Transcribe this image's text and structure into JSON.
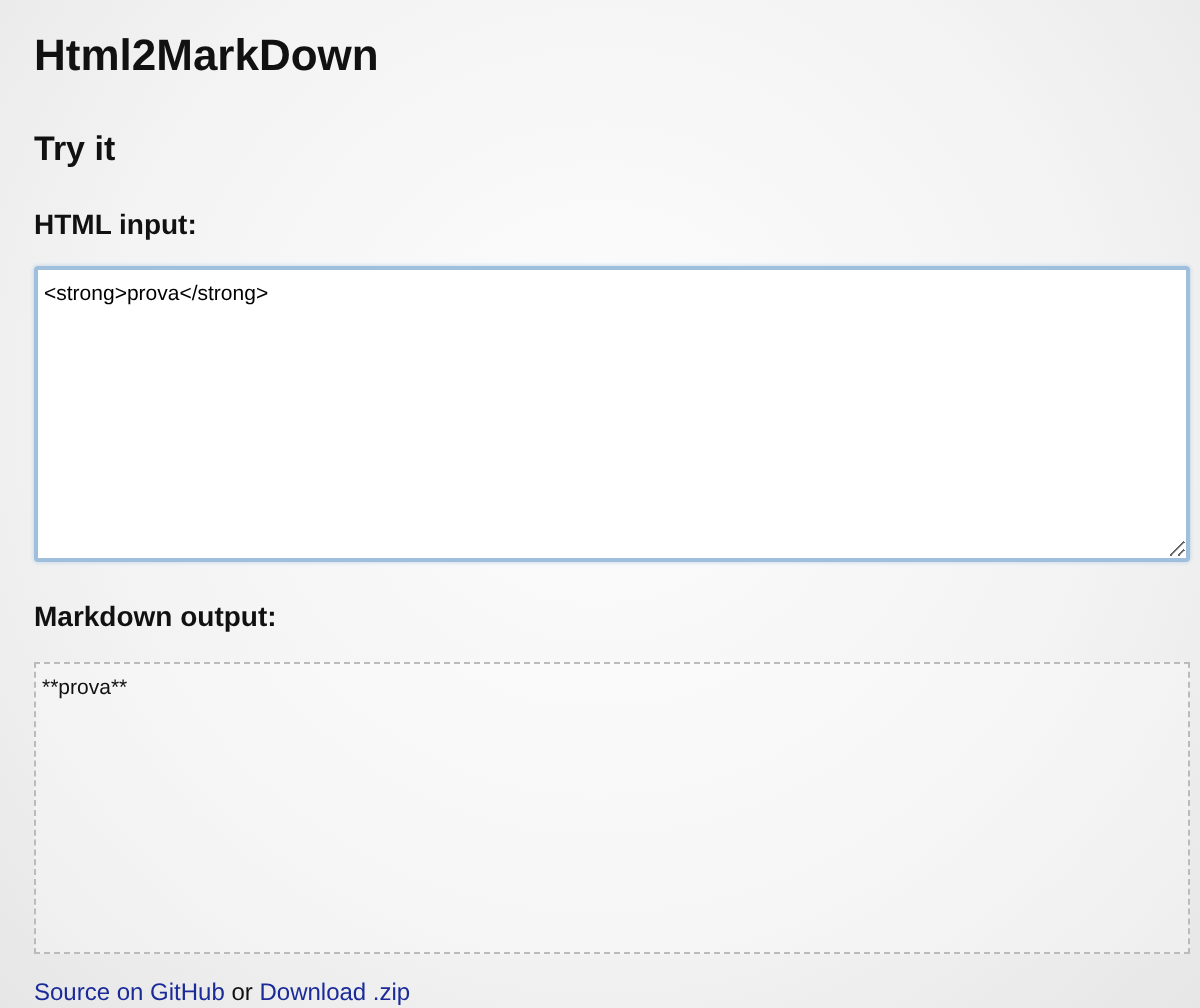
{
  "title": "Html2MarkDown",
  "section_title": "Try it",
  "html_input": {
    "label": "HTML input:",
    "value": "<strong>prova</strong>"
  },
  "markdown_output": {
    "label": "Markdown output:",
    "value": "**prova**"
  },
  "footer": {
    "links": [
      "Source on GitHub",
      "Download .zip"
    ],
    "separator": "or"
  }
}
